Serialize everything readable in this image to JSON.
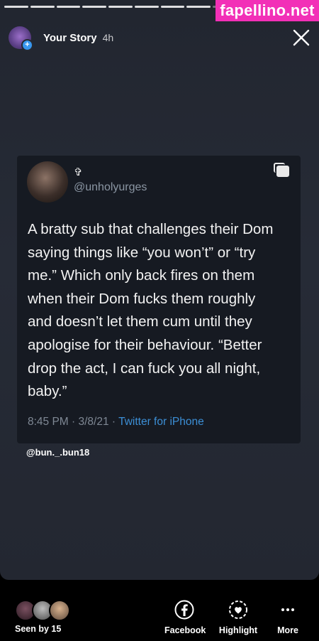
{
  "watermark": "fapellino.net",
  "story": {
    "title": "Your Story",
    "time": "4h"
  },
  "tweet": {
    "cross": "✞",
    "handle": "@unholyurges",
    "lines": [
      "A bratty sub that challenges their Dom",
      "saying things like “you won’t” or “try",
      "me.” Which only back fires on them",
      "when their Dom fucks them roughly",
      "and doesn’t let them cum until they",
      "apologise for their behaviour. “Better",
      "drop the act, I can fuck you all night,",
      "baby.”"
    ],
    "meta": "8:45 PM · 3/8/21 · ",
    "source": "Twitter for iPhone"
  },
  "mention": "@bun._.bun18",
  "bottom": {
    "seen_by": "Seen by 15",
    "facebook": "Facebook",
    "highlight": "Highlight",
    "more": "More"
  },
  "colors": {
    "watermark_bg": "#f230b7",
    "link": "#3c8fd6",
    "badge": "#3897f0"
  },
  "icons": {
    "close": "close-icon",
    "facebook": "facebook-icon",
    "highlight": "highlight-heart-icon",
    "more": "more-dots-icon",
    "copy": "copy-icon"
  }
}
